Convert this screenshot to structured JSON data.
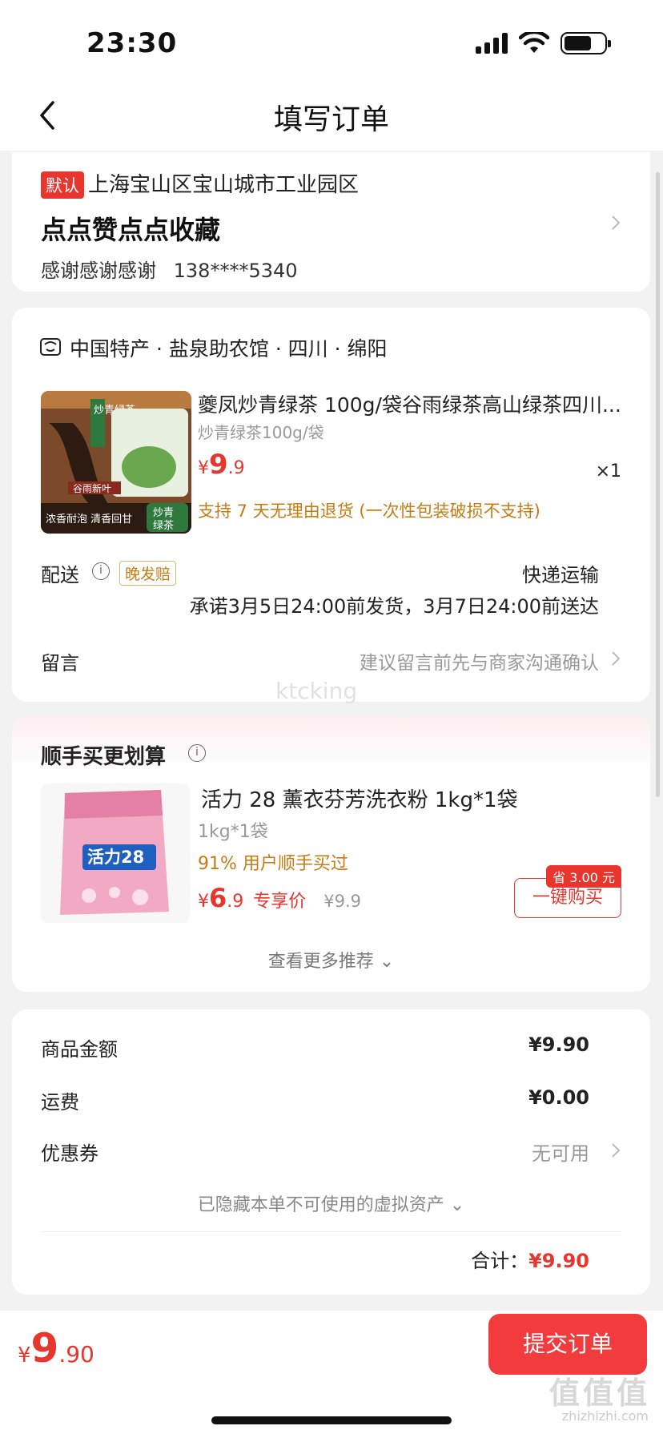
{
  "status_bar": {
    "time": "23:30"
  },
  "nav": {
    "title": "填写订单"
  },
  "address": {
    "tag": "默认",
    "region": "上海宝山区宝山城市工业园区",
    "detail": "点点赞点点收藏",
    "name": "感谢感谢感谢",
    "phone": "138****5340"
  },
  "shop": {
    "name": "中国特产 · 盐泉助农馆 · 四川 · 绵阳",
    "product": {
      "title": "夔凤炒青绿茶 100g/袋谷雨绿茶高山绿茶四川...",
      "spec": "炒青绿茶100g/袋",
      "price_currency": "¥",
      "price_int": "9",
      "price_dec": ".9",
      "qty": "×1",
      "return_policy": "支持 7 天无理由退货 (一次性包装破损不支持)",
      "image_texts": {
        "side": "炒青绿茶",
        "banner": "谷雨新叶",
        "slogan": "浓香耐泡 清香回甘",
        "badge_top": "炒青",
        "badge_bottom": "绿茶"
      }
    },
    "delivery": {
      "label": "配送",
      "tag": "晚发赔",
      "method": "快递运输",
      "promise": "承诺3月5日24:00前发货，3月7日24:00前送达"
    },
    "note": {
      "label": "留言",
      "placeholder": "建议留言前先与商家沟通确认"
    }
  },
  "recommend": {
    "title": "顺手买更划算",
    "item": {
      "name": "活力 28 薰衣芬芳洗衣粉 1kg*1袋",
      "spec": "1kg*1袋",
      "bought": "91% 用户顺手买过",
      "price_currency": "¥",
      "price_int": "6",
      "price_dec": ".9",
      "price_label": "专享价",
      "orig_price": "¥9.9",
      "save_badge": "省 3.00 元",
      "buy_label": "一键购买",
      "image_texts": {
        "brand": "活力28"
      }
    },
    "more": "查看更多推荐 ⌄"
  },
  "summary": {
    "goods_label": "商品金额",
    "goods_value": "¥9.90",
    "shipping_label": "运费",
    "shipping_value": "¥0.00",
    "coupon_label": "优惠券",
    "coupon_value": "无可用",
    "hidden_assets": "已隐藏本单不可使用的虚拟资产 ⌄",
    "total_label": "合计：",
    "total_value": "¥9.90"
  },
  "bottom": {
    "price_currency": "¥",
    "price_int": "9",
    "price_dec": ".90",
    "submit_label": "提交订单"
  },
  "watermarks": {
    "mid": "ktcking",
    "corner": "值值值",
    "corner_sub": "zhizhizhi.com"
  },
  "colors": {
    "accent": "#e8362e",
    "orange": "#c67c12",
    "submit": "#f13b3d"
  }
}
